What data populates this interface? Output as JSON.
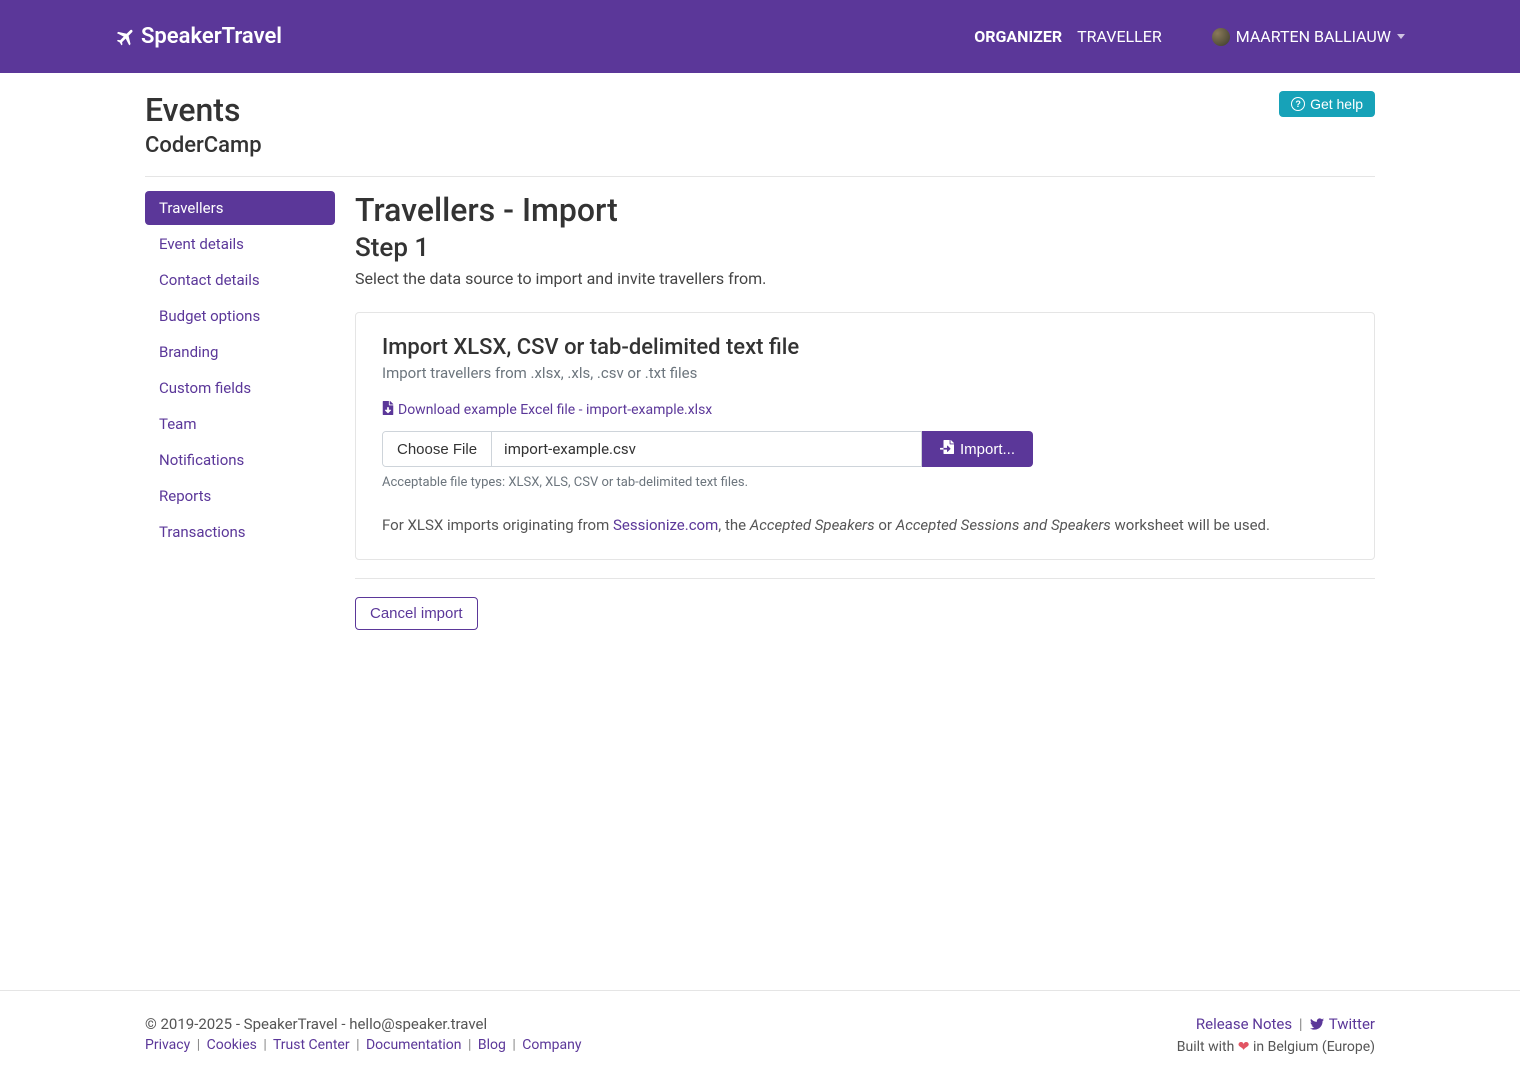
{
  "navbar": {
    "brand": "SpeakerTravel",
    "links": [
      {
        "label": "ORGANIZER",
        "active": true
      },
      {
        "label": "TRAVELLER",
        "active": false
      }
    ],
    "user_name": "MAARTEN BALLIAUW"
  },
  "header": {
    "title": "Events",
    "subtitle": "CoderCamp",
    "help_button": "Get help"
  },
  "sidebar": {
    "items": [
      {
        "label": "Travellers",
        "active": true
      },
      {
        "label": "Event details",
        "active": false
      },
      {
        "label": "Contact details",
        "active": false
      },
      {
        "label": "Budget options",
        "active": false
      },
      {
        "label": "Branding",
        "active": false
      },
      {
        "label": "Custom fields",
        "active": false
      },
      {
        "label": "Team",
        "active": false
      },
      {
        "label": "Notifications",
        "active": false
      },
      {
        "label": "Reports",
        "active": false
      },
      {
        "label": "Transactions",
        "active": false
      }
    ]
  },
  "main": {
    "heading": "Travellers - Import",
    "step_label": "Step 1",
    "step_description": "Select the data source to import and invite travellers from.",
    "card": {
      "title": "Import XLSX, CSV or tab-delimited text file",
      "subtitle": "Import travellers from .xlsx, .xls, .csv or .txt files",
      "download_link": "Download example Excel file - import-example.xlsx",
      "choose_file_label": "Choose File",
      "file_name": "import-example.csv",
      "import_button": "Import...",
      "acceptable_text": "Acceptable file types: XLSX, XLS, CSV or tab-delimited text files.",
      "info_prefix": "For XLSX imports originating from ",
      "info_link": "Sessionize.com",
      "info_mid1": ", the ",
      "info_em1": "Accepted Speakers",
      "info_mid2": " or ",
      "info_em2": "Accepted Sessions and Speakers",
      "info_suffix": " worksheet will be used."
    },
    "cancel_button": "Cancel import"
  },
  "footer": {
    "copyright": "© 2019-2025 - SpeakerTravel - hello@speaker.travel",
    "links": [
      "Privacy",
      "Cookies",
      "Trust Center",
      "Documentation",
      "Blog",
      "Company"
    ],
    "release_notes": "Release Notes",
    "twitter": "Twitter",
    "tagline_prefix": "Built with ",
    "tagline_suffix": " in Belgium (Europe)"
  }
}
